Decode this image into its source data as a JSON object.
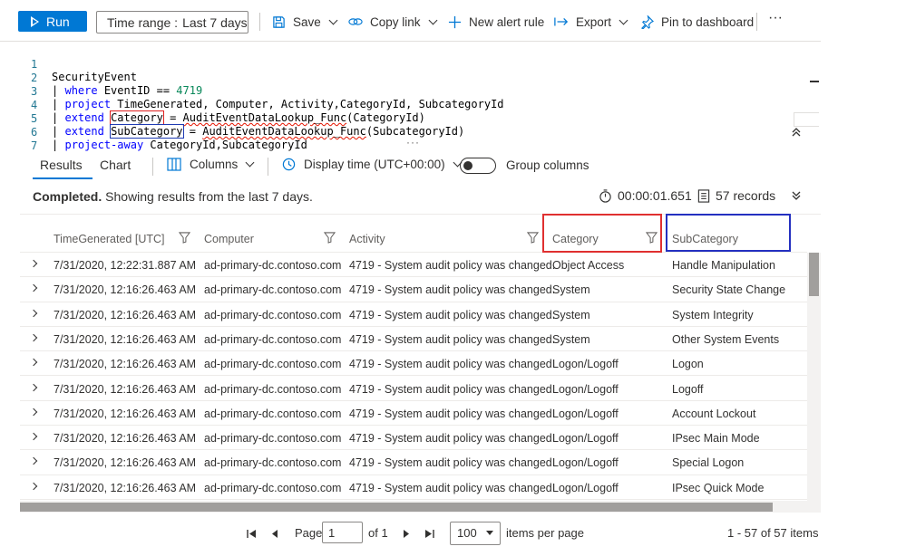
{
  "toolbar": {
    "run_label": "Run",
    "time_range_label": "Time range :",
    "time_range_value": "Last 7 days",
    "save_label": "Save",
    "copy_link_label": "Copy link",
    "new_alert_label": "New alert rule",
    "export_label": "Export",
    "pin_label": "Pin to dashboard",
    "more_label": "···"
  },
  "editor": {
    "line_numbers": [
      "1",
      "2",
      "3",
      "4",
      "5",
      "6",
      "7"
    ],
    "l1": "SecurityEvent",
    "l2_kw": "where",
    "l2_rest": " EventID == ",
    "l2_num": "4719",
    "l3_kw": "project",
    "l3_rest": " TimeGenerated, Computer, Activity,CategoryId, SubcategoryId",
    "l4_kw": "extend",
    "l4_col": "Category",
    "l4_eq": " = ",
    "l4_func": "AuditEventDataLookup_Func",
    "l4_arg": "(CategoryId)",
    "l5_kw": "extend",
    "l5_col": "SubCategory",
    "l5_eq": " = ",
    "l5_func": "AuditEventDataLookup_Func",
    "l5_arg": "(SubcategoryId)",
    "l6_kw": "project-away",
    "l6_rest": " CategoryId,SubcategoryId",
    "pipe": "|",
    "splitter_dots": "···"
  },
  "results_bar": {
    "tab_results": "Results",
    "tab_chart": "Chart",
    "columns_label": "Columns",
    "display_time_label": "Display time (UTC+00:00)",
    "group_columns_label": "Group columns"
  },
  "status": {
    "completed": "Completed.",
    "message": " Showing results from the last 7 days.",
    "duration": "00:00:01.651",
    "records": "57 records"
  },
  "grid": {
    "headers": [
      "TimeGenerated [UTC]",
      "Computer",
      "Activity",
      "Category",
      "SubCategory"
    ],
    "rows": [
      [
        "7/31/2020, 12:22:31.887 AM",
        "ad-primary-dc.contoso.com",
        "4719 - System audit policy was changed.",
        "Object Access",
        "Handle Manipulation"
      ],
      [
        "7/31/2020, 12:16:26.463 AM",
        "ad-primary-dc.contoso.com",
        "4719 - System audit policy was changed.",
        "System",
        "Security State Change"
      ],
      [
        "7/31/2020, 12:16:26.463 AM",
        "ad-primary-dc.contoso.com",
        "4719 - System audit policy was changed.",
        "System",
        "System Integrity"
      ],
      [
        "7/31/2020, 12:16:26.463 AM",
        "ad-primary-dc.contoso.com",
        "4719 - System audit policy was changed.",
        "System",
        "Other System Events"
      ],
      [
        "7/31/2020, 12:16:26.463 AM",
        "ad-primary-dc.contoso.com",
        "4719 - System audit policy was changed.",
        "Logon/Logoff",
        "Logon"
      ],
      [
        "7/31/2020, 12:16:26.463 AM",
        "ad-primary-dc.contoso.com",
        "4719 - System audit policy was changed.",
        "Logon/Logoff",
        "Logoff"
      ],
      [
        "7/31/2020, 12:16:26.463 AM",
        "ad-primary-dc.contoso.com",
        "4719 - System audit policy was changed.",
        "Logon/Logoff",
        "Account Lockout"
      ],
      [
        "7/31/2020, 12:16:26.463 AM",
        "ad-primary-dc.contoso.com",
        "4719 - System audit policy was changed.",
        "Logon/Logoff",
        "IPsec Main Mode"
      ],
      [
        "7/31/2020, 12:16:26.463 AM",
        "ad-primary-dc.contoso.com",
        "4719 - System audit policy was changed.",
        "Logon/Logoff",
        "Special Logon"
      ],
      [
        "7/31/2020, 12:16:26.463 AM",
        "ad-primary-dc.contoso.com",
        "4719 - System audit policy was changed.",
        "Logon/Logoff",
        "IPsec Quick Mode"
      ]
    ]
  },
  "pager": {
    "page_label": "Page",
    "page_value": "1",
    "of_label": "of 1",
    "per_page_value": "100",
    "items_per_page_label": "items per page",
    "range_label": "1 - 57 of 57 items"
  },
  "colors": {
    "accent": "#0078d4",
    "highlight_red": "#e03030",
    "highlight_blue": "#2430c0"
  }
}
